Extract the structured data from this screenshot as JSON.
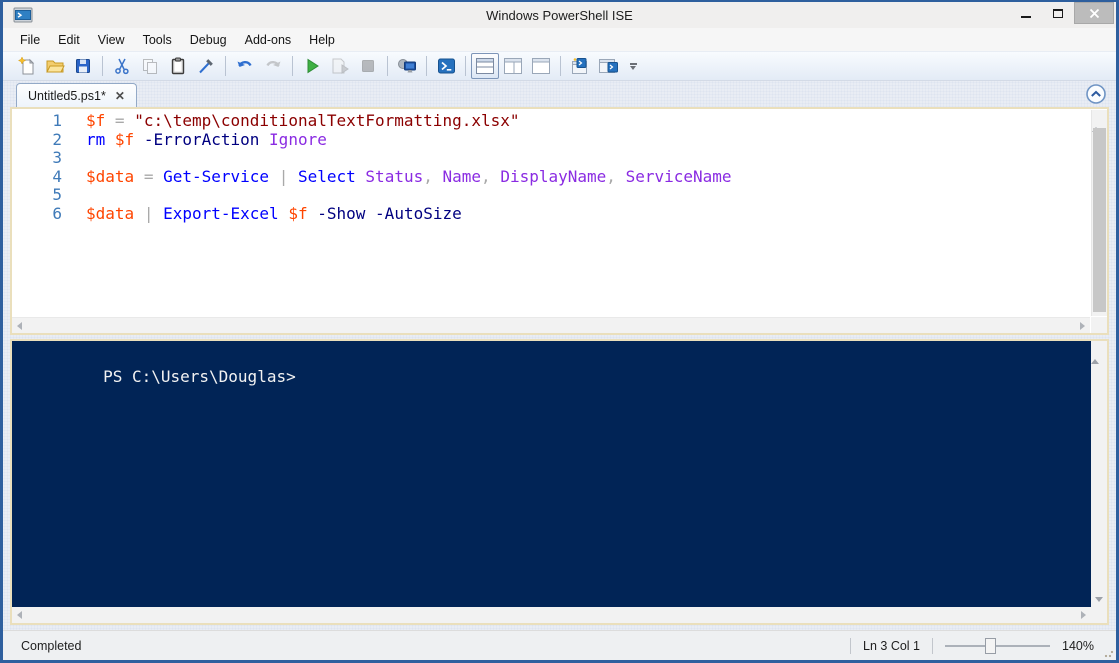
{
  "window": {
    "title": "Windows PowerShell ISE"
  },
  "menu": {
    "items": [
      "File",
      "Edit",
      "View",
      "Tools",
      "Debug",
      "Add-ons",
      "Help"
    ]
  },
  "toolbar": {
    "buttons": [
      {
        "name": "new-script",
        "icon": "new-file-icon",
        "enabled": true
      },
      {
        "name": "open-script",
        "icon": "open-folder-icon",
        "enabled": true
      },
      {
        "name": "save",
        "icon": "save-floppy-icon",
        "enabled": true
      },
      {
        "name": "cut",
        "icon": "scissors-icon",
        "enabled": true
      },
      {
        "name": "copy",
        "icon": "copy-icon",
        "enabled": false
      },
      {
        "name": "paste",
        "icon": "clipboard-icon",
        "enabled": true
      },
      {
        "name": "clear-console-pane",
        "icon": "clear-console-icon",
        "enabled": true
      },
      {
        "name": "undo",
        "icon": "undo-arrow-icon",
        "enabled": true
      },
      {
        "name": "redo",
        "icon": "redo-arrow-icon",
        "enabled": false
      },
      {
        "name": "run-script",
        "icon": "run-play-icon",
        "enabled": true
      },
      {
        "name": "run-selection",
        "icon": "run-selection-icon",
        "enabled": false
      },
      {
        "name": "stop-operation",
        "icon": "stop-square-icon",
        "enabled": false
      },
      {
        "name": "new-remote-powershell-tab",
        "icon": "remote-computer-icon",
        "enabled": true
      },
      {
        "name": "start-powershell",
        "icon": "powershell-icon",
        "enabled": true
      },
      {
        "name": "show-script-pane-top",
        "icon": "script-pane-top-icon",
        "enabled": true,
        "selected": true
      },
      {
        "name": "show-script-pane-right",
        "icon": "script-pane-right-icon",
        "enabled": true
      },
      {
        "name": "show-script-pane-maximized",
        "icon": "script-pane-maximized-icon",
        "enabled": true
      },
      {
        "name": "new-powershell-tab",
        "icon": "powershell-tab-new-icon",
        "enabled": true
      },
      {
        "name": "show-powershell-console",
        "icon": "powershell-tab-icon",
        "enabled": true
      },
      {
        "name": "toolbar-overflow",
        "icon": "overflow-chevron-icon",
        "enabled": true
      }
    ]
  },
  "tab": {
    "label": "Untitled5.ps1*",
    "close_glyph": "✕"
  },
  "editor": {
    "lines": [
      {
        "n": "1",
        "tokens": [
          {
            "t": "$f",
            "c": "variable"
          },
          {
            "t": " ",
            "c": "plain"
          },
          {
            "t": "=",
            "c": "operator"
          },
          {
            "t": " ",
            "c": "plain"
          },
          {
            "t": "\"c:\\temp\\conditionalTextFormatting.xlsx\"",
            "c": "string"
          }
        ]
      },
      {
        "n": "2",
        "tokens": [
          {
            "t": "rm",
            "c": "command"
          },
          {
            "t": " ",
            "c": "plain"
          },
          {
            "t": "$f",
            "c": "variable"
          },
          {
            "t": " ",
            "c": "plain"
          },
          {
            "t": "-ErrorAction",
            "c": "parameter"
          },
          {
            "t": " ",
            "c": "plain"
          },
          {
            "t": "Ignore",
            "c": "argument"
          }
        ]
      },
      {
        "n": "3",
        "tokens": []
      },
      {
        "n": "4",
        "tokens": [
          {
            "t": "$data",
            "c": "variable"
          },
          {
            "t": " ",
            "c": "plain"
          },
          {
            "t": "=",
            "c": "operator"
          },
          {
            "t": " ",
            "c": "plain"
          },
          {
            "t": "Get-Service",
            "c": "command"
          },
          {
            "t": " ",
            "c": "plain"
          },
          {
            "t": "|",
            "c": "operator"
          },
          {
            "t": " ",
            "c": "plain"
          },
          {
            "t": "Select",
            "c": "command"
          },
          {
            "t": " ",
            "c": "plain"
          },
          {
            "t": "Status",
            "c": "argument"
          },
          {
            "t": ",",
            "c": "operator"
          },
          {
            "t": " ",
            "c": "plain"
          },
          {
            "t": "Name",
            "c": "argument"
          },
          {
            "t": ",",
            "c": "operator"
          },
          {
            "t": " ",
            "c": "plain"
          },
          {
            "t": "DisplayName",
            "c": "argument"
          },
          {
            "t": ",",
            "c": "operator"
          },
          {
            "t": " ",
            "c": "plain"
          },
          {
            "t": "ServiceName",
            "c": "argument"
          }
        ]
      },
      {
        "n": "5",
        "tokens": []
      },
      {
        "n": "6",
        "tokens": [
          {
            "t": "$data",
            "c": "variable"
          },
          {
            "t": " ",
            "c": "plain"
          },
          {
            "t": "|",
            "c": "operator"
          },
          {
            "t": " ",
            "c": "plain"
          },
          {
            "t": "Export-Excel",
            "c": "command"
          },
          {
            "t": " ",
            "c": "plain"
          },
          {
            "t": "$f",
            "c": "variable"
          },
          {
            "t": " ",
            "c": "plain"
          },
          {
            "t": "-Show",
            "c": "parameter"
          },
          {
            "t": " ",
            "c": "plain"
          },
          {
            "t": "-AutoSize",
            "c": "parameter"
          }
        ]
      }
    ]
  },
  "console": {
    "prompt": "PS C:\\Users\\Douglas>"
  },
  "statusbar": {
    "status": "Completed",
    "position": "Ln 3 Col 1",
    "zoom": "140%"
  },
  "colors": {
    "window_border": "#2e5f9e",
    "pane_border": "#eadfbc",
    "console_bg": "#012456",
    "variable": "#ff4500",
    "command": "#0000ff",
    "parameter": "#000080",
    "string": "#8b0000",
    "operator": "#a9a9a9",
    "argument": "#8a2be2",
    "line_number": "#3f7ab8"
  }
}
